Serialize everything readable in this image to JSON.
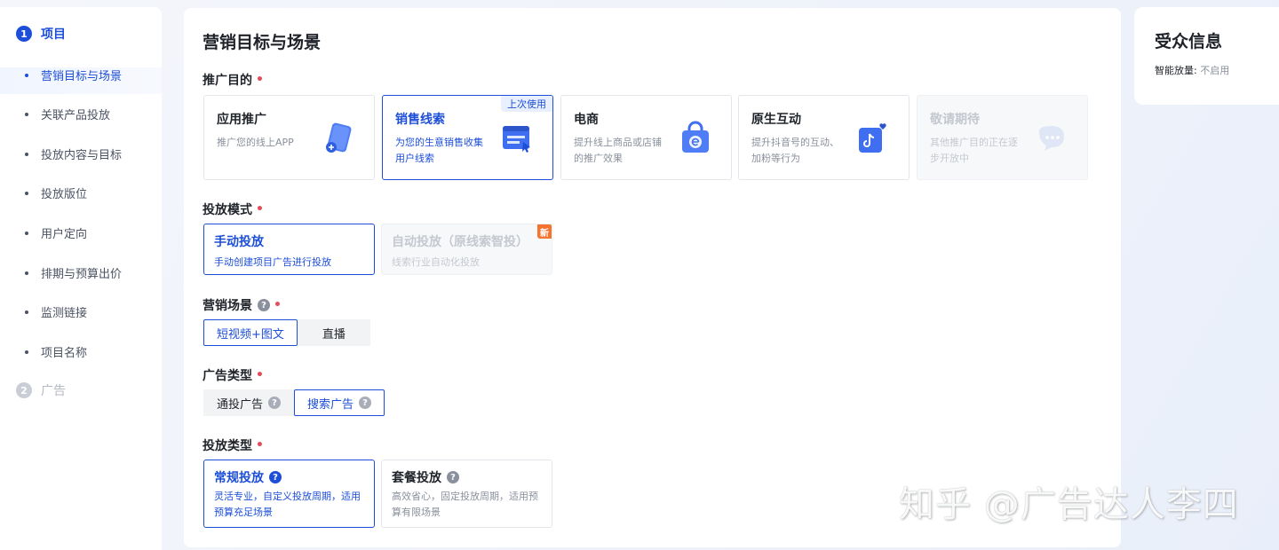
{
  "nav": {
    "step1": {
      "num": "1",
      "label": "项目"
    },
    "items": [
      {
        "label": "营销目标与场景"
      },
      {
        "label": "关联产品投放"
      },
      {
        "label": "投放内容与目标"
      },
      {
        "label": "投放版位"
      },
      {
        "label": "用户定向"
      },
      {
        "label": "排期与预算出价"
      },
      {
        "label": "监测链接"
      },
      {
        "label": "项目名称"
      }
    ],
    "step2": {
      "num": "2",
      "label": "广告"
    }
  },
  "main": {
    "title": "营销目标与场景",
    "purpose": {
      "label": "推广目的",
      "required": "•",
      "cards": [
        {
          "title": "应用推广",
          "desc": "推广您的线上APP",
          "icon": "app-phone-icon"
        },
        {
          "title": "销售线索",
          "desc": "为您的生意销售收集用户线索",
          "icon": "lead-form-icon",
          "tag": "上次使用"
        },
        {
          "title": "电商",
          "desc": "提升线上商品或店铺的推广效果",
          "icon": "shopping-bag-icon"
        },
        {
          "title": "原生互动",
          "desc": "提升抖音号的互动、加粉等行为",
          "icon": "douyin-interact-icon"
        },
        {
          "title": "敬请期待",
          "desc": "其他推广目的正在逐步开放中",
          "icon": "chat-bubble-icon"
        }
      ]
    },
    "mode": {
      "label": "投放模式",
      "required": "•",
      "options": [
        {
          "title": "手动投放",
          "desc": "手动创建项目广告进行投放"
        },
        {
          "title": "自动投放（原线索智投）",
          "desc": "线索行业自动化投放",
          "badge": "新"
        }
      ]
    },
    "scene": {
      "label": "营销场景",
      "help": "?",
      "required": "•",
      "options": [
        "短视频+图文",
        "直播"
      ]
    },
    "adtype": {
      "label": "广告类型",
      "required": "•",
      "options": [
        {
          "label": "通投广告",
          "help": "?"
        },
        {
          "label": "搜索广告",
          "help": "?"
        }
      ]
    },
    "deliverytype": {
      "label": "投放类型",
      "required": "•",
      "options": [
        {
          "title": "常规投放",
          "help": "?",
          "desc": "灵活专业，自定义投放周期，适用预算充足场景"
        },
        {
          "title": "套餐投放",
          "help": "?",
          "desc": "高效省心，固定投放周期，适用预算有限场景"
        }
      ]
    }
  },
  "audience": {
    "title": "受众信息",
    "smart_label": "智能放量:",
    "smart_value": "不启用"
  },
  "watermark": "知乎 @广告达人李四",
  "colors": {
    "accent": "#1d4ed8",
    "required": "#e34d59",
    "new_badge": "#f5722f"
  }
}
